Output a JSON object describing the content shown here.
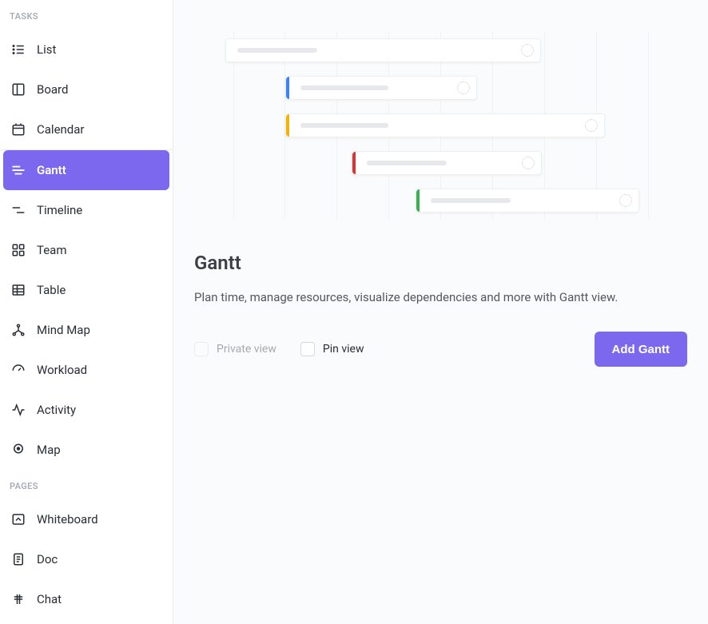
{
  "sidebar": {
    "tasks_header": "TASKS",
    "pages_header": "PAGES",
    "tasks": [
      {
        "label": "List",
        "icon": "list",
        "active": false
      },
      {
        "label": "Board",
        "icon": "board",
        "active": false
      },
      {
        "label": "Calendar",
        "icon": "calendar",
        "active": false
      },
      {
        "label": "Gantt",
        "icon": "gantt",
        "active": true
      },
      {
        "label": "Timeline",
        "icon": "timeline",
        "active": false
      },
      {
        "label": "Team",
        "icon": "team",
        "active": false
      },
      {
        "label": "Table",
        "icon": "table",
        "active": false
      },
      {
        "label": "Mind Map",
        "icon": "mindmap",
        "active": false
      },
      {
        "label": "Workload",
        "icon": "workload",
        "active": false
      },
      {
        "label": "Activity",
        "icon": "activity",
        "active": false
      },
      {
        "label": "Map",
        "icon": "map",
        "active": false
      }
    ],
    "pages": [
      {
        "label": "Whiteboard",
        "icon": "whiteboard"
      },
      {
        "label": "Doc",
        "icon": "doc"
      },
      {
        "label": "Chat",
        "icon": "chat"
      }
    ]
  },
  "main": {
    "title": "Gantt",
    "subtitle": "Plan time, manage resources, visualize dependencies and more with Gantt view.",
    "private_label": "Private view",
    "pin_label": "Pin view",
    "add_button": "Add Gantt"
  }
}
